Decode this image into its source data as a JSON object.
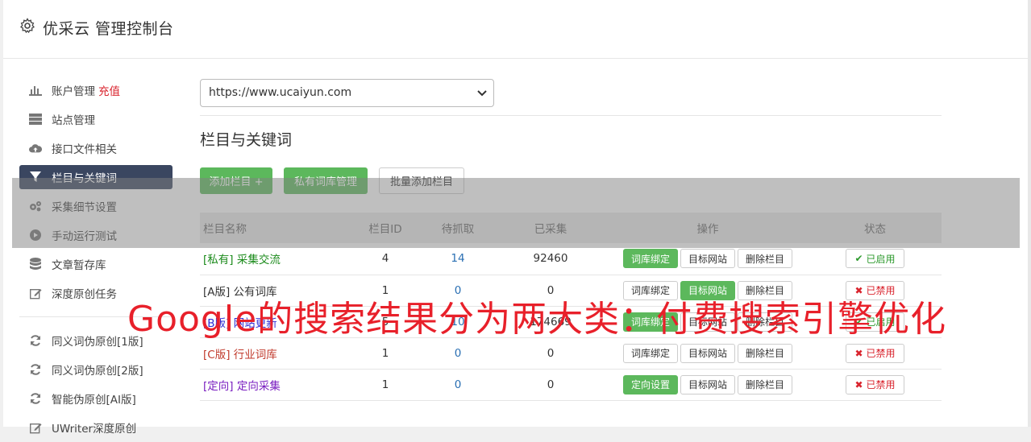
{
  "header": {
    "title": "优采云 管理控制台",
    "icon": "gear-icon"
  },
  "sidebar": {
    "items": [
      {
        "label": "账户管理",
        "extra": "充值",
        "icon": "bar-chart-icon"
      },
      {
        "label": "站点管理",
        "icon": "server-icon"
      },
      {
        "label": "接口文件相关",
        "icon": "cloud-upload-icon"
      },
      {
        "label": "栏目与关键词",
        "icon": "filter-icon",
        "active": true
      },
      {
        "label": "采集细节设置",
        "icon": "cogs-icon"
      },
      {
        "label": "手动运行测试",
        "icon": "play-circle-icon"
      },
      {
        "label": "文章暂存库",
        "icon": "database-icon"
      },
      {
        "label": "深度原创任务",
        "icon": "edit-icon"
      }
    ],
    "items2": [
      {
        "label": "同义词伪原创[1版]",
        "icon": "refresh-icon"
      },
      {
        "label": "同义词伪原创[2版]",
        "icon": "refresh-icon"
      },
      {
        "label": "智能伪原创[AI版]",
        "icon": "refresh-icon"
      },
      {
        "label": "UWriter深度原创",
        "icon": "edit-icon"
      }
    ]
  },
  "main": {
    "site_select": "https://www.ucaiyun.com",
    "section_title": "栏目与关键词",
    "buttons": {
      "add": "添加栏目 +",
      "private": "私有词库管理",
      "batch": "批量添加栏目"
    },
    "columns": [
      "栏目名称",
      "栏目ID",
      "待抓取",
      "已采集",
      "操作",
      "状态"
    ],
    "rows": [
      {
        "name": "[私有] 采集交流",
        "id": "4",
        "pending": "14",
        "collected": "92460",
        "op1": "词库绑定",
        "op2": "目标网站",
        "op3": "删除栏目",
        "state": "已启用"
      },
      {
        "name": "[A版] 公有词库",
        "id": "1",
        "pending": "0",
        "collected": "0",
        "op1": "词库绑定",
        "op2": "目标网站",
        "op3": "删除栏目",
        "state": "已禁用"
      },
      {
        "name": "[B版] 网站更新",
        "id": "5",
        "pending": "10",
        "collected": "174669",
        "op1": "词库绑定",
        "op2": "目标网站",
        "op3": "删除栏目",
        "state": "已启用"
      },
      {
        "name": "[C版] 行业词库",
        "id": "1",
        "pending": "0",
        "collected": "0",
        "op1": "词库绑定",
        "op2": "目标网站",
        "op3": "删除栏目",
        "state": "已禁用"
      },
      {
        "name": "[定向] 定向采集",
        "id": "1",
        "pending": "0",
        "collected": "0",
        "op1": "定向设置",
        "op2": "目标网站",
        "op3": "删除栏目",
        "state": "已禁用"
      }
    ]
  },
  "watermark": "Google的搜索结果分为两大类：付费搜索引擎优化",
  "colors": {
    "active_bg": "#3a4660",
    "green": "#5cb85c",
    "red": "#d9232d"
  }
}
